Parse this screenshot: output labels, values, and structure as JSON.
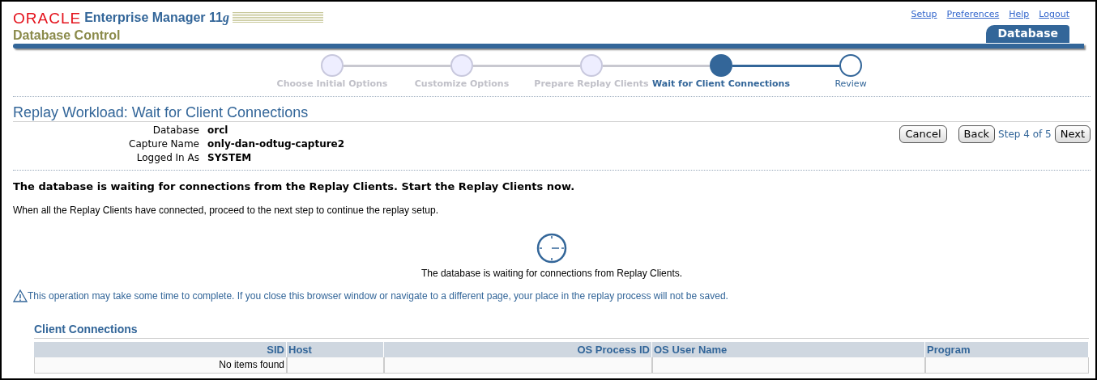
{
  "brand": {
    "oracle": "ORACLE",
    "product": "Enterprise Manager 11",
    "version": "g",
    "subtitle": "Database Control"
  },
  "global_links": [
    "Setup",
    "Preferences",
    "Help",
    "Logout"
  ],
  "tab": {
    "label": "Database",
    "selected": true
  },
  "steps": [
    {
      "label": "Choose Initial Options",
      "kind": "done"
    },
    {
      "label": "Customize Options",
      "kind": "done"
    },
    {
      "label": "Prepare Replay Clients",
      "kind": "done"
    },
    {
      "label": "Wait for Client Connections",
      "kind": "current"
    },
    {
      "label": "Review",
      "kind": "todo"
    }
  ],
  "page_title": "Replay Workload: Wait for Client Connections",
  "info": [
    {
      "label": "Database",
      "value": "orcl"
    },
    {
      "label": "Capture Name",
      "value": "only-dan-odtug-capture2"
    },
    {
      "label": "Logged In As",
      "value": "SYSTEM"
    }
  ],
  "buttons": {
    "cancel": "Cancel",
    "back": "Back",
    "step": "Step 4 of 5",
    "next": "Next"
  },
  "headline": "The database is waiting for connections from the Replay Clients. Start the Replay Clients now.",
  "instruction": "When all the Replay Clients have connected, proceed to the next step to continue the replay setup.",
  "waiting_text": "The database is waiting for connections from Replay Clients.",
  "warning": "This operation may take some time to complete. If you close this browser window or navigate to a different page, your place in the replay process will not be saved.",
  "table": {
    "title": "Client Connections",
    "columns": [
      {
        "label": "SID",
        "kind": "number"
      },
      {
        "label": "Host",
        "kind": "text"
      },
      {
        "label": "OS Process ID",
        "kind": "number"
      },
      {
        "label": "OS User Name",
        "kind": "text"
      },
      {
        "label": "Program",
        "kind": "text"
      }
    ],
    "rows": [
      [
        "No items found",
        "",
        "",
        "",
        ""
      ]
    ]
  }
}
